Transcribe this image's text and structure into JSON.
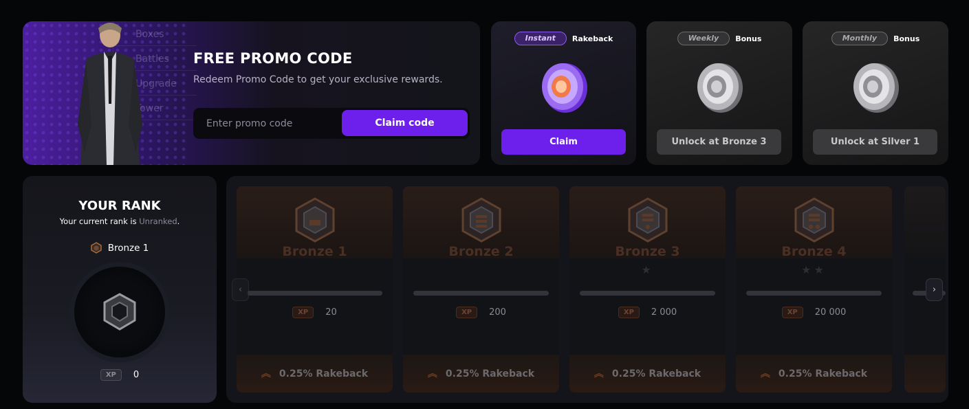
{
  "promo": {
    "menu_items": [
      "Boxes",
      "Battles",
      "Upgrade",
      "Tower"
    ],
    "title": "FREE PROMO CODE",
    "subtitle": "Redeem Promo Code to get your exclusive rewards.",
    "input_placeholder": "Enter promo code",
    "claim_label": "Claim code"
  },
  "rewards": [
    {
      "tag": "Instant",
      "label": "Rakeback",
      "button": "Claim",
      "state": "active"
    },
    {
      "tag": "Weekly",
      "label": "Bonus",
      "button": "Unlock at Bronze 3",
      "state": "locked"
    },
    {
      "tag": "Monthly",
      "label": "Bonus",
      "button": "Unlock at Silver 1",
      "state": "locked"
    }
  ],
  "rank": {
    "title": "YOUR RANK",
    "subtitle_prefix": "Your current rank is ",
    "subtitle_value": "Unranked",
    "subtitle_suffix": ".",
    "current_rank": "Bronze 1",
    "xp_tag": "XP",
    "xp_value": "0"
  },
  "tiers": [
    {
      "name": "Bronze 1",
      "stars": "",
      "xp_tag": "XP",
      "xp": "20",
      "reward": "0.25% Rakeback"
    },
    {
      "name": "Bronze 2",
      "stars": "",
      "xp_tag": "XP",
      "xp": "200",
      "reward": "0.25% Rakeback"
    },
    {
      "name": "Bronze 3",
      "stars": "★",
      "xp_tag": "XP",
      "xp": "2 000",
      "reward": "0.25% Rakeback"
    },
    {
      "name": "Bronze 4",
      "stars": "★★",
      "xp_tag": "XP",
      "xp": "20 000",
      "reward": "0.25% Rakeback"
    }
  ],
  "nav": {
    "prev": "‹",
    "next": "›"
  },
  "colors": {
    "accent": "#6d20ec",
    "bronze": "#4a2f22",
    "background": "#050607"
  }
}
